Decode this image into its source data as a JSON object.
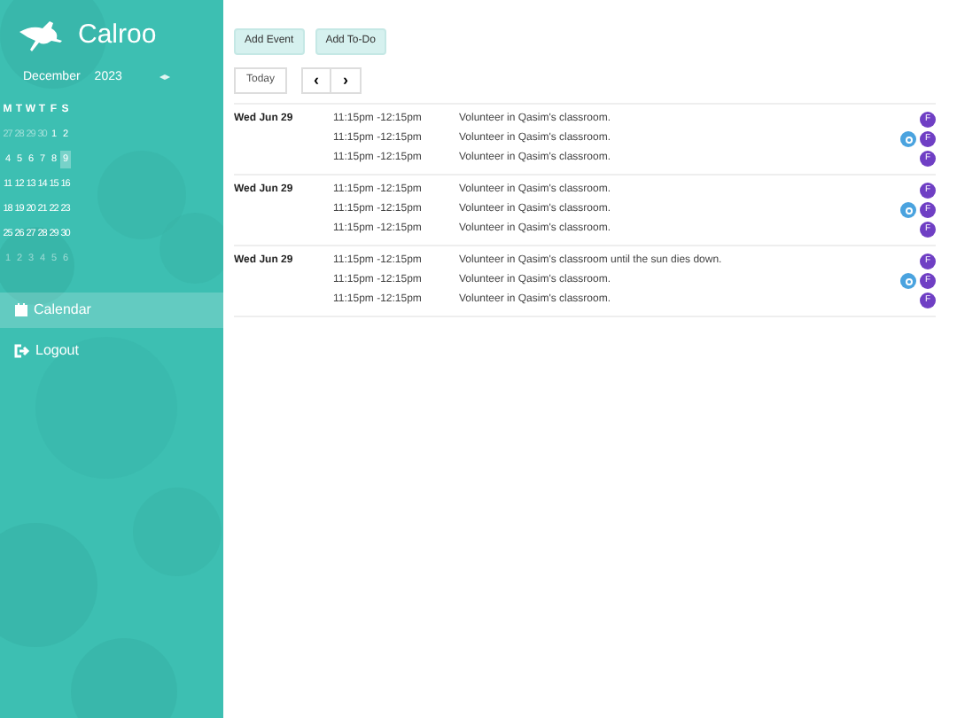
{
  "brand": "Calroo",
  "mini_calendar": {
    "month": "December",
    "year": "2023",
    "nav": "◂▸",
    "weekdays": [
      "M",
      "T",
      "W",
      "T",
      "F",
      "S"
    ],
    "weeks": [
      [
        {
          "day": "27",
          "muted": true,
          "selected": false
        },
        {
          "day": "28",
          "muted": true,
          "selected": false
        },
        {
          "day": "29",
          "muted": true,
          "selected": false
        },
        {
          "day": "30",
          "muted": true,
          "selected": false
        },
        {
          "day": "1",
          "muted": false,
          "selected": false
        },
        {
          "day": "2",
          "muted": false,
          "selected": false
        }
      ],
      [
        {
          "day": "4",
          "muted": false,
          "selected": false
        },
        {
          "day": "5",
          "muted": false,
          "selected": false
        },
        {
          "day": "6",
          "muted": false,
          "selected": false
        },
        {
          "day": "7",
          "muted": false,
          "selected": false
        },
        {
          "day": "8",
          "muted": false,
          "selected": false
        },
        {
          "day": "9",
          "muted": false,
          "selected": true
        }
      ],
      [
        {
          "day": "11",
          "muted": false,
          "selected": false
        },
        {
          "day": "12",
          "muted": false,
          "selected": false
        },
        {
          "day": "13",
          "muted": false,
          "selected": false
        },
        {
          "day": "14",
          "muted": false,
          "selected": false
        },
        {
          "day": "15",
          "muted": false,
          "selected": false
        },
        {
          "day": "16",
          "muted": false,
          "selected": false
        }
      ],
      [
        {
          "day": "18",
          "muted": false,
          "selected": false
        },
        {
          "day": "19",
          "muted": false,
          "selected": false
        },
        {
          "day": "20",
          "muted": false,
          "selected": false
        },
        {
          "day": "21",
          "muted": false,
          "selected": false
        },
        {
          "day": "22",
          "muted": false,
          "selected": false
        },
        {
          "day": "23",
          "muted": false,
          "selected": false
        }
      ],
      [
        {
          "day": "25",
          "muted": false,
          "selected": false
        },
        {
          "day": "26",
          "muted": false,
          "selected": false
        },
        {
          "day": "27",
          "muted": false,
          "selected": false
        },
        {
          "day": "28",
          "muted": false,
          "selected": false
        },
        {
          "day": "29",
          "muted": false,
          "selected": false
        },
        {
          "day": "30",
          "muted": false,
          "selected": false
        }
      ],
      [
        {
          "day": "1",
          "muted": true,
          "selected": false
        },
        {
          "day": "2",
          "muted": true,
          "selected": false
        },
        {
          "day": "3",
          "muted": true,
          "selected": false
        },
        {
          "day": "4",
          "muted": true,
          "selected": false
        },
        {
          "day": "5",
          "muted": true,
          "selected": false
        },
        {
          "day": "6",
          "muted": true,
          "selected": false
        }
      ]
    ]
  },
  "nav": [
    {
      "label": "Calendar",
      "selected": true,
      "kind": "calendar"
    },
    {
      "label": "Logout",
      "selected": false,
      "kind": "logout"
    }
  ],
  "toolbar": {
    "buttons": [
      "Add Event",
      "Add To-Do"
    ],
    "today": "Today",
    "prev": "‹",
    "next": "›"
  },
  "days": [
    {
      "date": "Wed Jun 29",
      "events": [
        {
          "time": "11:15pm -12:15pm",
          "title": "Volunteer in Qasim's classroom.",
          "badges": [
            {
              "kind": "letter",
              "text": "F"
            }
          ]
        },
        {
          "time": "11:15pm -12:15pm",
          "title": "Volunteer in Qasim's classroom.",
          "badges": [
            {
              "kind": "circle"
            },
            {
              "kind": "letter",
              "text": "F"
            }
          ]
        },
        {
          "time": "11:15pm -12:15pm",
          "title": "Volunteer in Qasim's classroom.",
          "badges": [
            {
              "kind": "letter",
              "text": "F"
            }
          ]
        }
      ]
    },
    {
      "date": "Wed Jun 29",
      "events": [
        {
          "time": "11:15pm -12:15pm",
          "title": "Volunteer in Qasim's classroom.",
          "badges": [
            {
              "kind": "letter",
              "text": "F"
            }
          ]
        },
        {
          "time": "11:15pm -12:15pm",
          "title": "Volunteer in Qasim's classroom.",
          "badges": [
            {
              "kind": "circle"
            },
            {
              "kind": "letter",
              "text": "F"
            }
          ]
        },
        {
          "time": "11:15pm -12:15pm",
          "title": "Volunteer in Qasim's classroom.",
          "badges": [
            {
              "kind": "letter",
              "text": "F"
            }
          ]
        }
      ]
    },
    {
      "date": "Wed Jun 29",
      "events": [
        {
          "time": "11:15pm -12:15pm",
          "title": "Volunteer in Qasim's classroom until the sun dies down.",
          "badges": [
            {
              "kind": "letter",
              "text": "F"
            }
          ]
        },
        {
          "time": "11:15pm -12:15pm",
          "title": "Volunteer in Qasim's classroom.",
          "badges": [
            {
              "kind": "circle"
            },
            {
              "kind": "letter",
              "text": "F"
            }
          ]
        },
        {
          "time": "11:15pm -12:15pm",
          "title": "Volunteer in Qasim's classroom.",
          "badges": [
            {
              "kind": "letter",
              "text": "F"
            }
          ]
        }
      ]
    }
  ]
}
